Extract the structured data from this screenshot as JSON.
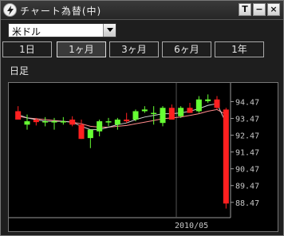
{
  "window": {
    "title": "チャート為替(中)",
    "buttons": [
      "T",
      "−",
      "×"
    ]
  },
  "pair_select": {
    "value": "米ドル"
  },
  "tabs": [
    {
      "label": "1日",
      "active": false
    },
    {
      "label": "1ヶ月",
      "active": true
    },
    {
      "label": "3ヶ月",
      "active": false
    },
    {
      "label": "6ヶ月",
      "active": false
    },
    {
      "label": "1年",
      "active": false
    }
  ],
  "period_label": "日足",
  "colors": {
    "up": "#66ff33",
    "down": "#ff2020",
    "ma_short": "#d0d0d0",
    "ma_long": "#ff8a8a",
    "axis_text": "#c8c8c8"
  },
  "chart_data": {
    "type": "candlestick",
    "yticks": [
      94.47,
      93.47,
      92.47,
      91.47,
      90.47,
      89.47,
      88.47
    ],
    "ylim": [
      87.7,
      95.3
    ],
    "x_date_label": "2010/05",
    "candles": [
      {
        "o": 93.9,
        "h": 94.2,
        "l": 93.4,
        "c": 93.4
      },
      {
        "o": 93.1,
        "h": 93.7,
        "l": 92.8,
        "c": 93.3
      },
      {
        "o": 93.4,
        "h": 93.5,
        "l": 93.05,
        "c": 93.25
      },
      {
        "o": 93.3,
        "h": 93.55,
        "l": 93.0,
        "c": 93.3
      },
      {
        "o": 93.3,
        "h": 93.5,
        "l": 92.8,
        "c": 93.3
      },
      {
        "o": 93.3,
        "h": 93.55,
        "l": 93.1,
        "c": 93.3
      },
      {
        "o": 93.4,
        "h": 93.6,
        "l": 93.0,
        "c": 93.1
      },
      {
        "o": 93.1,
        "h": 93.4,
        "l": 92.25,
        "c": 92.25
      },
      {
        "o": 92.3,
        "h": 92.8,
        "l": 91.7,
        "c": 92.8
      },
      {
        "o": 92.7,
        "h": 93.4,
        "l": 92.4,
        "c": 93.3
      },
      {
        "o": 93.3,
        "h": 93.5,
        "l": 93.0,
        "c": 93.3
      },
      {
        "o": 93.1,
        "h": 93.5,
        "l": 92.8,
        "c": 93.4
      },
      {
        "o": 93.4,
        "h": 93.8,
        "l": 93.2,
        "c": 93.3
      },
      {
        "o": 93.4,
        "h": 94.0,
        "l": 93.3,
        "c": 93.9
      },
      {
        "o": 93.9,
        "h": 94.2,
        "l": 93.8,
        "c": 94.0
      },
      {
        "o": 93.8,
        "h": 94.2,
        "l": 93.1,
        "c": 93.8
      },
      {
        "o": 93.2,
        "h": 94.2,
        "l": 93.0,
        "c": 94.1
      },
      {
        "o": 94.1,
        "h": 94.3,
        "l": 93.4,
        "c": 93.4
      },
      {
        "o": 93.6,
        "h": 94.2,
        "l": 93.5,
        "c": 94.1
      },
      {
        "o": 94.1,
        "h": 94.4,
        "l": 93.8,
        "c": 93.8
      },
      {
        "o": 93.9,
        "h": 94.8,
        "l": 93.8,
        "c": 94.6
      },
      {
        "o": 94.5,
        "h": 94.9,
        "l": 94.4,
        "c": 94.6
      },
      {
        "o": 94.6,
        "h": 94.8,
        "l": 94.0,
        "c": 94.1
      },
      {
        "o": 94.0,
        "h": 94.1,
        "l": 88.1,
        "c": 88.4
      }
    ],
    "ma_short": [
      93.7,
      93.5,
      93.4,
      93.3,
      93.3,
      93.3,
      93.25,
      93.0,
      92.8,
      92.8,
      92.95,
      93.1,
      93.2,
      93.4,
      93.55,
      93.65,
      93.75,
      93.75,
      93.8,
      93.9,
      94.05,
      94.25,
      94.35,
      93.2
    ],
    "ma_long": [
      93.6,
      93.5,
      93.45,
      93.4,
      93.35,
      93.3,
      93.25,
      93.15,
      93.0,
      92.95,
      92.95,
      93.0,
      93.05,
      93.15,
      93.25,
      93.35,
      93.45,
      93.5,
      93.55,
      93.65,
      93.75,
      93.9,
      94.0,
      93.7
    ]
  }
}
